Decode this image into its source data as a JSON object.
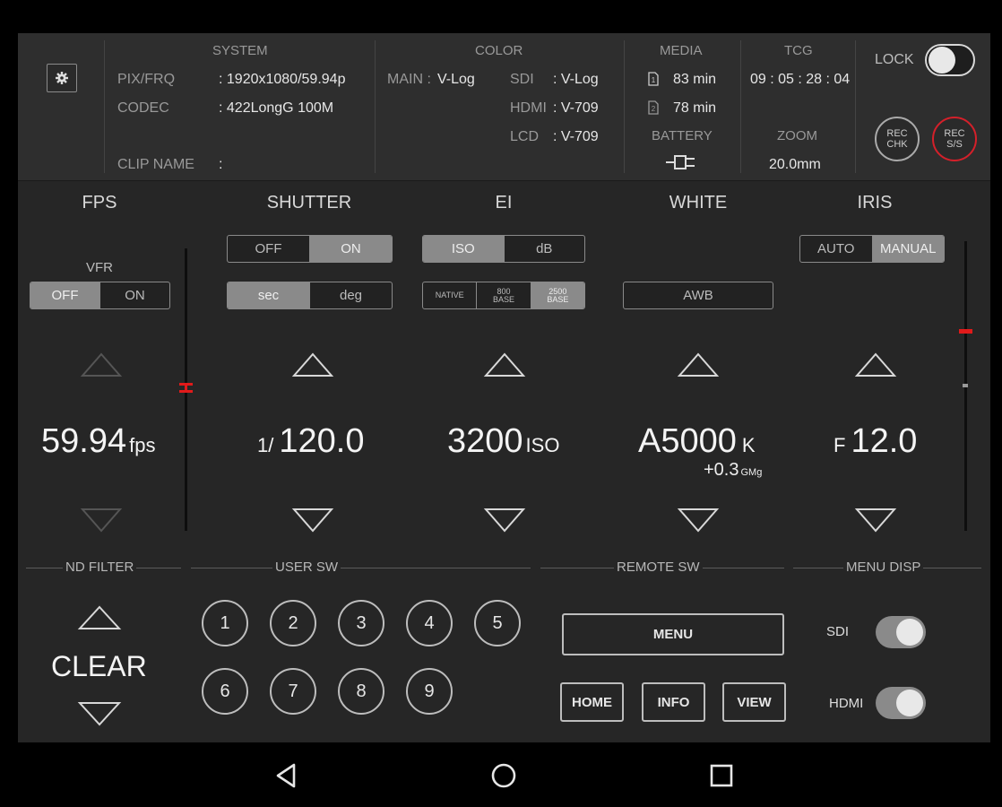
{
  "header": {
    "settings_icon": "gear-icon",
    "system": {
      "title": "SYSTEM",
      "pix_frq_label": "PIX/FRQ",
      "pix_frq_value": ": 1920x1080/59.94p",
      "codec_label": "CODEC",
      "codec_value": ": 422LongG 100M",
      "clip_name_label": "CLIP NAME",
      "clip_name_value": ":"
    },
    "color": {
      "title": "COLOR",
      "main_label": "MAIN :",
      "main_value": "V-Log",
      "sdi_label": "SDI",
      "sdi_value": ": V-Log",
      "hdmi_label": "HDMI",
      "hdmi_value": ": V-709",
      "lcd_label": "LCD",
      "lcd_value": ": V-709"
    },
    "media": {
      "title": "MEDIA",
      "slot1_icon": "sd-card-1-icon",
      "slot1_value": "83 min",
      "slot2_icon": "sd-card-2-icon",
      "slot2_value": "78 min",
      "battery_title": "BATTERY",
      "battery_icon": "ac-plug-icon"
    },
    "tcg": {
      "title": "TCG",
      "value": "09 : 05 : 28 : 04",
      "zoom_title": "ZOOM",
      "zoom_value": "20.0mm"
    },
    "lock": {
      "label": "LOCK",
      "state": "off"
    },
    "rec_chk": {
      "line1": "REC",
      "line2": "CHK"
    },
    "rec_ss": {
      "line1": "REC",
      "line2": "S/S",
      "color": "#d4202a"
    }
  },
  "fps": {
    "title": "FPS",
    "vfr_label": "VFR",
    "vfr_off": "OFF",
    "vfr_on": "ON",
    "value": "59.94",
    "unit": "fps"
  },
  "shutter": {
    "title": "SHUTTER",
    "off": "OFF",
    "on": "ON",
    "sec": "sec",
    "deg": "deg",
    "prefix": "1/",
    "value": "120.0"
  },
  "ei": {
    "title": "EI",
    "iso": "ISO",
    "db": "dB",
    "native": "NATIVE",
    "base800_a": "800",
    "base800_b": "BASE",
    "base2500_a": "2500",
    "base2500_b": "BASE",
    "value": "3200",
    "unit": "ISO"
  },
  "white": {
    "title": "WHITE",
    "awb": "AWB",
    "value": "A5000",
    "unit": "K",
    "sub_value": "+0.3",
    "sub_unit": "GMg"
  },
  "iris": {
    "title": "IRIS",
    "auto": "AUTO",
    "manual": "MANUAL",
    "prefix": "F",
    "value": "12.0"
  },
  "nd_filter": {
    "title": "ND FILTER",
    "value": "CLEAR"
  },
  "user_sw": {
    "title": "USER SW",
    "buttons": [
      "1",
      "2",
      "3",
      "4",
      "5",
      "6",
      "7",
      "8",
      "9"
    ]
  },
  "remote_sw": {
    "title": "REMOTE SW",
    "menu": "MENU",
    "home": "HOME",
    "info": "INFO",
    "view": "VIEW"
  },
  "menu_disp": {
    "title": "MENU DISP",
    "sdi": "SDI",
    "hdmi": "HDMI",
    "sdi_state": "on",
    "hdmi_state": "on"
  },
  "navbar": {
    "back_icon": "back-triangle-icon",
    "home_icon": "home-circle-icon",
    "recents_icon": "recents-square-icon"
  }
}
